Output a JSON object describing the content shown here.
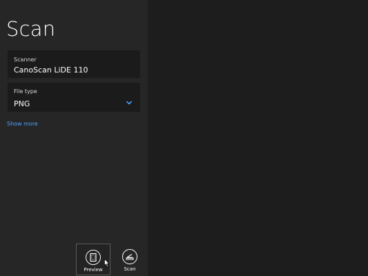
{
  "header": {
    "title": "Scan"
  },
  "settings": {
    "scanner": {
      "label": "Scanner",
      "value": "CanoScan LiDE 110"
    },
    "file_type": {
      "label": "File type",
      "value": "PNG",
      "icon": "chevron-down-icon"
    },
    "show_more_label": "Show more"
  },
  "app_bar": {
    "preview": {
      "label": "Preview",
      "icon": "preview-icon"
    },
    "scan": {
      "label": "Scan",
      "icon": "scanner-icon"
    }
  },
  "colors": {
    "accent": "#4aa3ff",
    "left_pane": "#262626",
    "right_pane": "#1d1d1d",
    "card": "#1b1b1b"
  }
}
